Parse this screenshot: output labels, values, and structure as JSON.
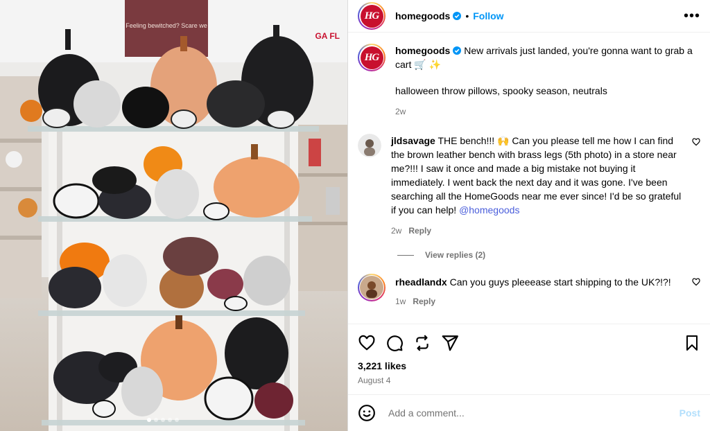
{
  "post": {
    "username": "homegoods",
    "logo_text": "HG",
    "follow_label": "Follow",
    "separator": "•",
    "more_label": "•••",
    "caption": "New arrivals just landed, you're gonna want to grab a cart 🛒 ✨",
    "tags": "halloween throw pillows, spooky season, neutrals",
    "caption_age": "2w",
    "store_sign": "Feeling bewitched? Scare we",
    "store_sign_right": "GA FL"
  },
  "comments": [
    {
      "username": "jldsavage",
      "text": "THE bench!!! 🙌 Can you please tell me how I can find the brown leather bench with brass legs (5th photo) in a store near me?!!! I saw it once and made a big mistake not buying it immediately. I went back the next day and it was gone. I've been searching all the HomeGoods near me ever since! I'd be so grateful if you can help!",
      "mention": "@homegoods",
      "age": "2w",
      "reply_label": "Reply",
      "view_replies": "View replies (2)"
    },
    {
      "username": "rheadlandx",
      "text": "Can you guys pleeease start shipping to the UK?!?!",
      "age": "1w",
      "reply_label": "Reply"
    }
  ],
  "actions": {
    "icons": [
      "heart-icon",
      "comment-icon",
      "share-icon",
      "send-icon",
      "bookmark-icon"
    ],
    "likes": "3,221 likes",
    "date": "August 4"
  },
  "add_comment": {
    "placeholder": "Add a comment...",
    "post_label": "Post"
  },
  "colors": {
    "accent": "#0095f6",
    "brand": "#c8102e",
    "mention": "#4a5edb",
    "muted": "#737373"
  }
}
